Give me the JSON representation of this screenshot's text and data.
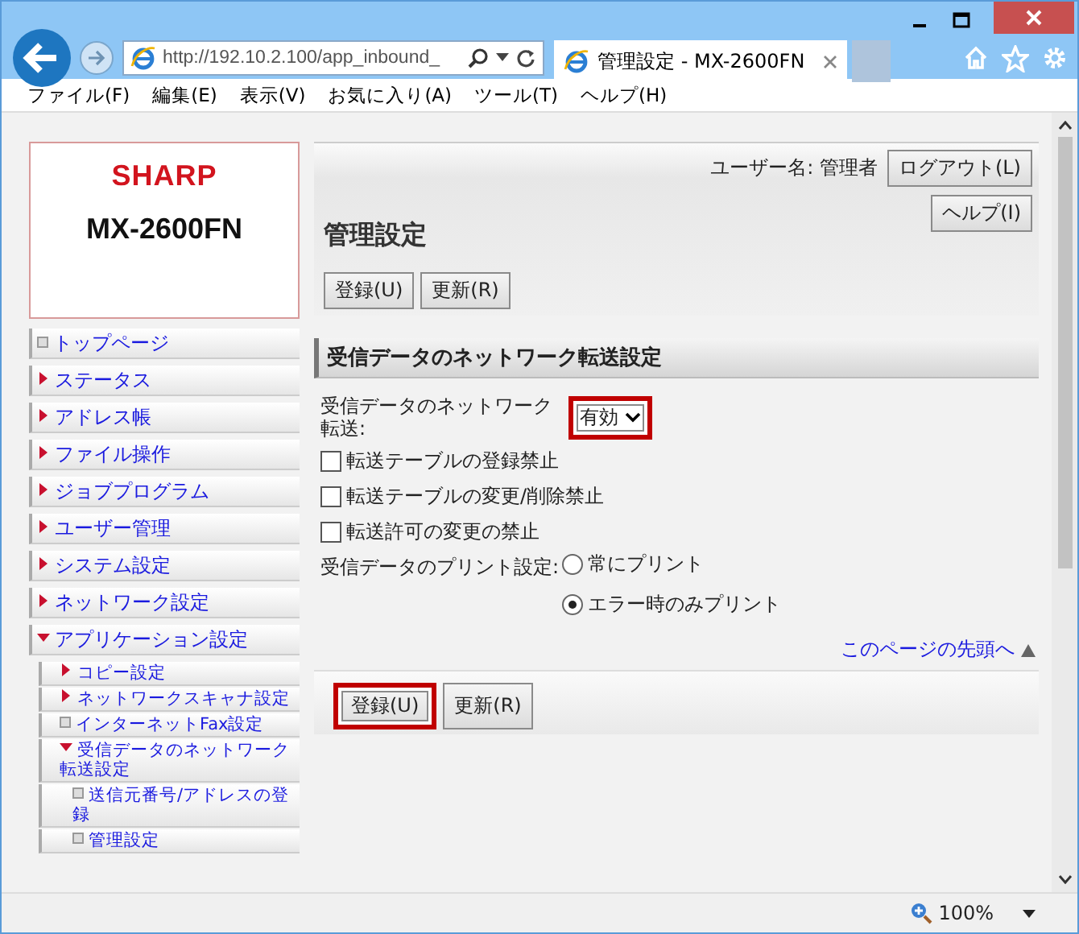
{
  "browser": {
    "address": "http://192.10.2.100/app_inbound_",
    "tab_title": "管理設定 - MX-2600FN",
    "menu": [
      "ファイル(F)",
      "編集(E)",
      "表示(V)",
      "お気に入り(A)",
      "ツール(T)",
      "ヘルプ(H)"
    ],
    "zoom": "100%"
  },
  "sidebar": {
    "logo": "SHARP",
    "model": "MX-2600FN",
    "items": [
      {
        "label": "トップページ",
        "kind": "page"
      },
      {
        "label": "ステータス",
        "kind": "folder",
        "expanded": false
      },
      {
        "label": "アドレス帳",
        "kind": "folder",
        "expanded": false
      },
      {
        "label": "ファイル操作",
        "kind": "folder",
        "expanded": false
      },
      {
        "label": "ジョブプログラム",
        "kind": "folder",
        "expanded": false
      },
      {
        "label": "ユーザー管理",
        "kind": "folder",
        "expanded": false
      },
      {
        "label": "システム設定",
        "kind": "folder",
        "expanded": false
      },
      {
        "label": "ネットワーク設定",
        "kind": "folder",
        "expanded": false
      },
      {
        "label": "アプリケーション設定",
        "kind": "folder",
        "expanded": true,
        "children": [
          {
            "label": "コピー設定",
            "kind": "folder",
            "expanded": false
          },
          {
            "label": "ネットワークスキャナ設定",
            "kind": "folder",
            "expanded": false
          },
          {
            "label": "インターネットFax設定",
            "kind": "page"
          },
          {
            "label": "受信データのネットワーク転送設定",
            "kind": "folder",
            "expanded": true,
            "children": [
              {
                "label": "送信元番号/アドレスの登録",
                "kind": "page"
              },
              {
                "label": "管理設定",
                "kind": "page"
              }
            ]
          }
        ]
      }
    ]
  },
  "header": {
    "user": "ユーザー名: 管理者",
    "logout": "ログアウト(L)",
    "help": "ヘルプ(I)",
    "title": "管理設定",
    "buttons": [
      {
        "label": "登録(U)",
        "highlighted": false
      },
      {
        "label": "更新(R)",
        "highlighted": false
      }
    ]
  },
  "section": {
    "title": "受信データのネットワーク転送設定",
    "transfer": {
      "label": "受信データのネットワーク転送:",
      "value": "有効",
      "highlighted": true
    },
    "checkboxes": [
      {
        "label": "転送テーブルの登録禁止",
        "checked": false
      },
      {
        "label": "転送テーブルの変更/削除禁止",
        "checked": false
      },
      {
        "label": "転送許可の変更の禁止",
        "checked": false
      }
    ],
    "print": {
      "label": "受信データのプリント設定:",
      "options": [
        {
          "label": "常にプリント",
          "selected": false
        },
        {
          "label": "エラー時のみプリント",
          "selected": true
        }
      ]
    },
    "top_link": "このページの先頭へ",
    "buttons": [
      {
        "label": "登録(U)",
        "highlighted": true
      },
      {
        "label": "更新(R)",
        "highlighted": false
      }
    ]
  }
}
